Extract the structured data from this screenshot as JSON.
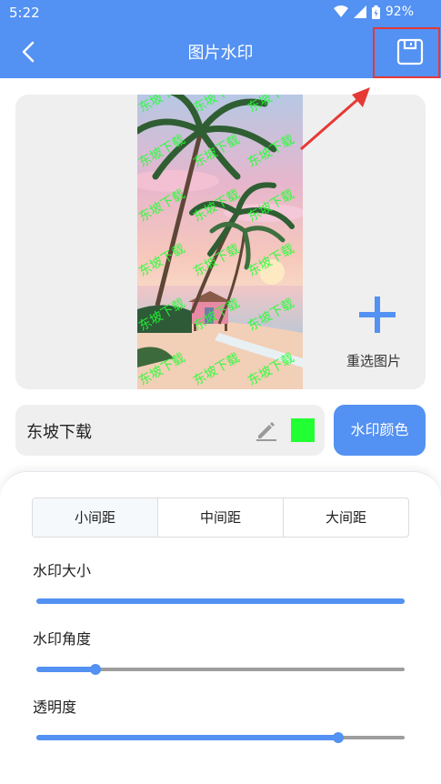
{
  "status_bar": {
    "time": "5:22",
    "battery_percent": "92%"
  },
  "app_bar": {
    "title": "图片水印"
  },
  "preview": {
    "reselect_label": "重选图片"
  },
  "watermark": {
    "text": "东坡下载",
    "color": "#22ff33",
    "overlay_text": "东坡下载"
  },
  "buttons": {
    "color_label": "水印颜色"
  },
  "spacing": {
    "options": [
      "小间距",
      "中间距",
      "大间距"
    ],
    "selected": "小间距"
  },
  "sliders": [
    {
      "label": "水印大小",
      "value": 1.0
    },
    {
      "label": "水印角度",
      "value": 0.16
    },
    {
      "label": "透明度",
      "value": 0.82
    }
  ],
  "colors": {
    "primary": "#5391f2",
    "annotation": "#e53935"
  }
}
